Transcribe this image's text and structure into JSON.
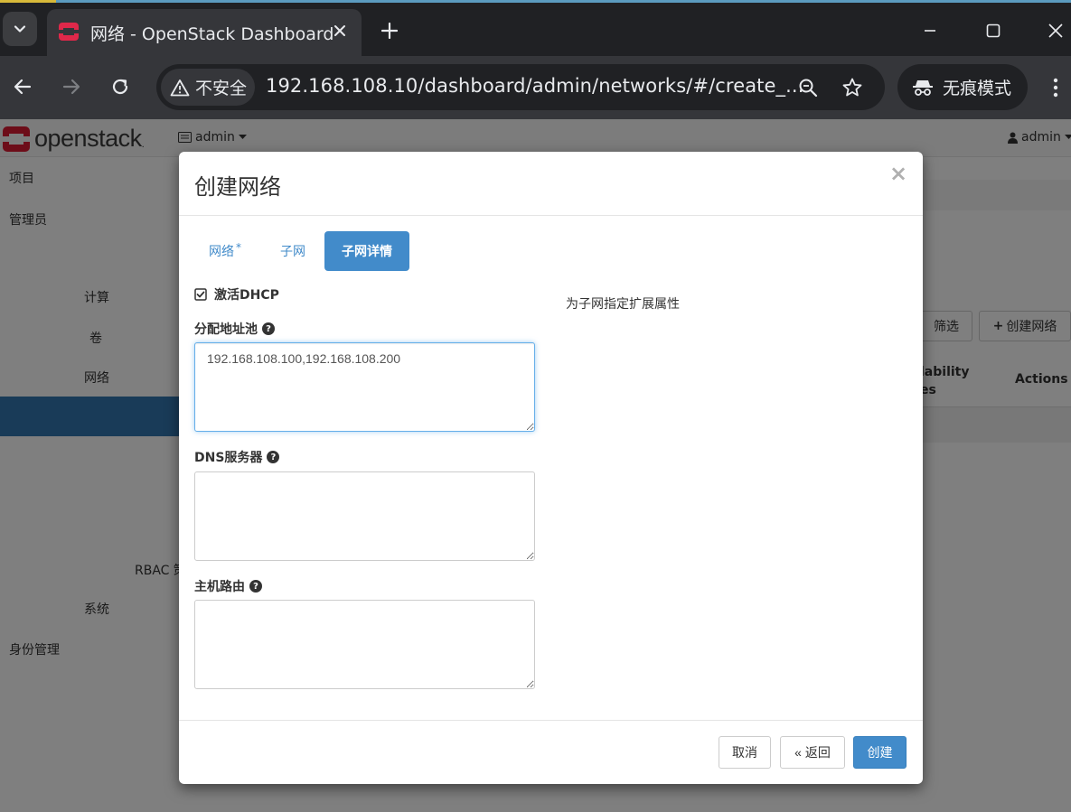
{
  "browser": {
    "tab_title": "网络 - OpenStack Dashboard",
    "security_label": "不安全",
    "url": "192.168.108.10/dashboard/admin/networks/#/create_...",
    "incognito_label": "无痕模式"
  },
  "navbar": {
    "logo_text": "openstack",
    "project_menu": "admin",
    "user_menu": "admin"
  },
  "sidebar": {
    "items": [
      "项目",
      "管理员",
      "计算",
      "卷",
      "网络",
      "RBAC 策",
      "系统",
      "身份管理"
    ]
  },
  "background": {
    "filter_button": "筛选",
    "create_network_button": "创建网络",
    "column_availability": "lability\nes",
    "column_actions": "Actions"
  },
  "modal": {
    "title": "创建网络",
    "close_symbol": "×",
    "tabs": [
      {
        "label": "网络",
        "required_mark": "*"
      },
      {
        "label": "子网"
      },
      {
        "label": "子网详情",
        "active": true
      }
    ],
    "enable_dhcp_label": "激活DHCP",
    "enable_dhcp_checked": true,
    "help_text": "为子网指定扩展属性",
    "allocation_pools_label": "分配地址池",
    "allocation_pools_value": "192.168.108.100,192.168.108.200",
    "dns_servers_label": "DNS服务器",
    "dns_servers_value": "",
    "host_routes_label": "主机路由",
    "host_routes_value": "",
    "cancel_button": "取消",
    "back_button": "« 返回",
    "create_button": "创建"
  },
  "colors": {
    "primary": "#428bca",
    "sidebar_active": "#3276b1",
    "chrome_dark": "#202124",
    "chrome_toolbar": "#35363a",
    "openstack_red": "#da1a32"
  }
}
